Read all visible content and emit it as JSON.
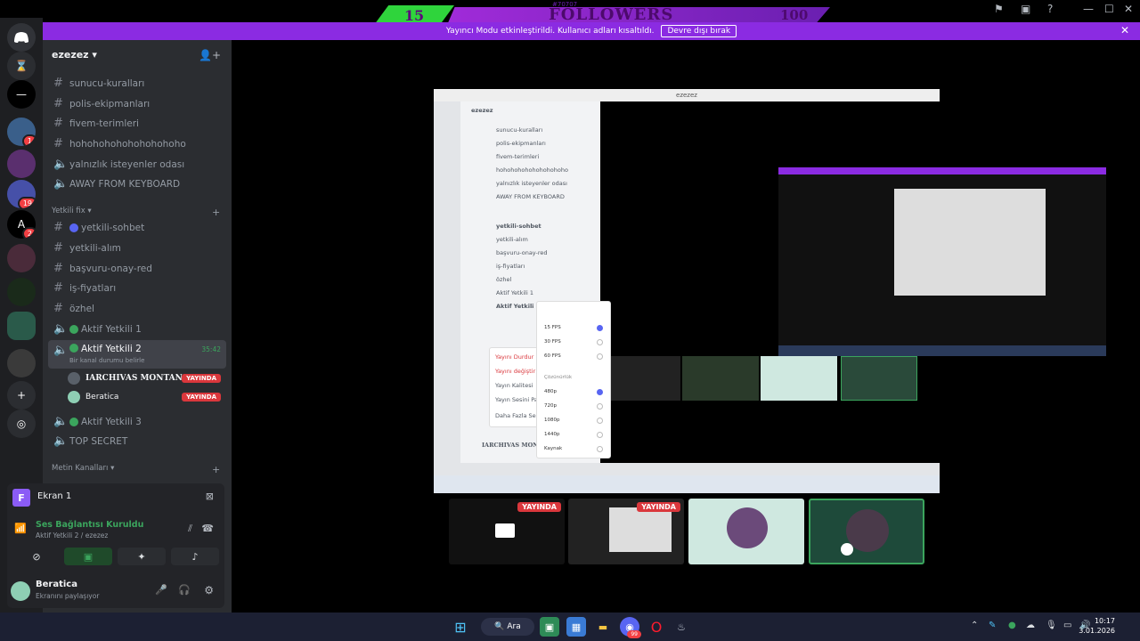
{
  "overlay": {
    "count_left": "15",
    "title": "FOLLOWERS",
    "count_right": "100",
    "small": "#70707"
  },
  "banner": {
    "text": "Yayıncı Modu etkinleştirildi. Kullanıcı adları kısaltıldı.",
    "button": "Devre dışı bırak"
  },
  "server": {
    "name": "ezezez"
  },
  "channels": [
    {
      "icon": "#",
      "name": "sunucu-kuralları"
    },
    {
      "icon": "#",
      "name": "polis-ekipmanları"
    },
    {
      "icon": "#",
      "name": "fivem-terimleri"
    },
    {
      "icon": "#",
      "name": "hohohohohohohohohoho"
    },
    {
      "icon": "speaker",
      "name": "yalnızlık isteyenler odası"
    },
    {
      "icon": "speaker",
      "name": "AWAY FROM KEYBOARD"
    }
  ],
  "category1": "Yetkili fix",
  "channels2": [
    {
      "icon": "#",
      "name": "yetkili-sohbet"
    },
    {
      "icon": "#",
      "name": "yetkili-alım"
    },
    {
      "icon": "#",
      "name": "başvuru-onay-red"
    },
    {
      "icon": "#",
      "name": "iş-fiyatları"
    },
    {
      "icon": "#",
      "name": "özhel"
    },
    {
      "icon": "speaker",
      "name": "Aktif Yetkili 1"
    },
    {
      "icon": "speaker",
      "name": "Aktif Yetkili 2"
    }
  ],
  "active_channel": {
    "timer": "35:42",
    "status": "Bir kanal durumu belirle"
  },
  "voice_users": [
    {
      "name": "IARCHIVAS MONTANA",
      "badge": "YAYINDA"
    },
    {
      "name": "Beratica",
      "badge": "YAYINDA"
    }
  ],
  "channels3": [
    {
      "icon": "speaker",
      "name": "Aktif Yetkili 3"
    },
    {
      "icon": "speaker",
      "name": "TOP SECRET"
    }
  ],
  "category2": "Metin Kanalları",
  "screen_panel": {
    "initial": "F",
    "title": "Ekran 1"
  },
  "voice_panel": {
    "status": "Ses Bağlantısı Kuruldu",
    "channel": "Aktif Yetkili 2 / ezezez"
  },
  "user_panel": {
    "name": "Beratica",
    "status": "Ekranını paylaşıyor"
  },
  "rail_badges": {
    "b1": "1",
    "b2": "19",
    "b3": "2"
  },
  "thumbnails": [
    {
      "badge": "YAYINDA"
    },
    {
      "badge": "YAYINDA"
    },
    {
      "badge": ""
    },
    {
      "badge": ""
    }
  ],
  "taskbar": {
    "search": "Ara",
    "time": "10:17",
    "date": "3.01.2026",
    "discord_badge": "99"
  },
  "stream_inner": {
    "server": "ezezez",
    "channels": [
      "sunucu-kuralları",
      "polis-ekipmanları",
      "fivem-terimleri",
      "hohohohohohohohohoho",
      "yalnızlık isteyenler odası",
      "AWAY FROM KEYBOARD",
      "yetkili-sohbet",
      "yetkili-alım",
      "başvuru-onay-red",
      "iş-fiyatları",
      "özhel",
      "Aktif Yetkili 1",
      "Aktif Yetkili 2"
    ],
    "user": "IARCHIVAS MONTANA",
    "menu": [
      "15 FPS",
      "30 FPS",
      "60 FPS",
      "Çözünürlük",
      "480p",
      "720p",
      "1080p",
      "1440p",
      "Kaynak"
    ],
    "ctx": [
      "Yayını Durdur",
      "Yayını değiştir",
      "Yayın Kalitesi",
      "Yayın Sesini Paylaş",
      "Daha Fazla Seçenek"
    ]
  },
  "colors": {
    "rail": "#1e1f22",
    "sidebar": "#2b2d31",
    "accent_purple": "#8b2be2",
    "live_red": "#da373c",
    "voice_green": "#3ba55d"
  }
}
